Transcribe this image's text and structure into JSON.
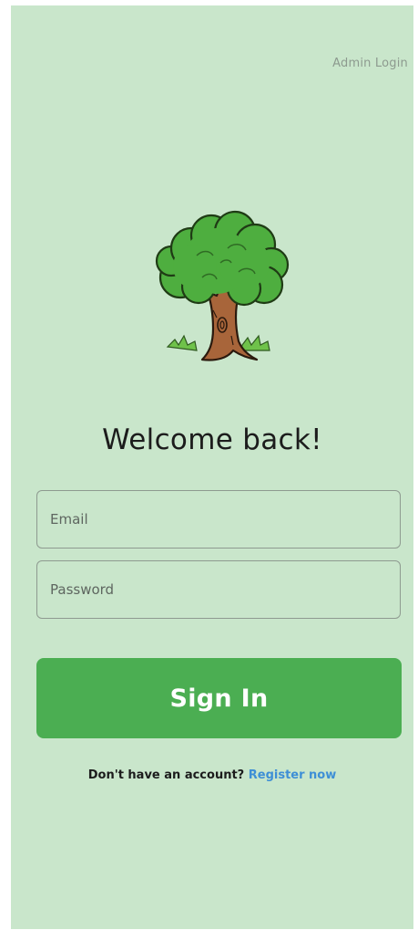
{
  "header": {
    "admin_login_label": "Admin Login"
  },
  "logo": {
    "icon": "tree-icon"
  },
  "main": {
    "title": "Welcome back!"
  },
  "form": {
    "email_placeholder": "Email",
    "password_placeholder": "Password",
    "sign_in_label": "Sign In"
  },
  "footer": {
    "prompt_text": "Don't have an account?",
    "register_label": "Register now"
  },
  "colors": {
    "background": "#c9e6cb",
    "primary_button": "#4bae52",
    "link": "#3e8fd6"
  }
}
